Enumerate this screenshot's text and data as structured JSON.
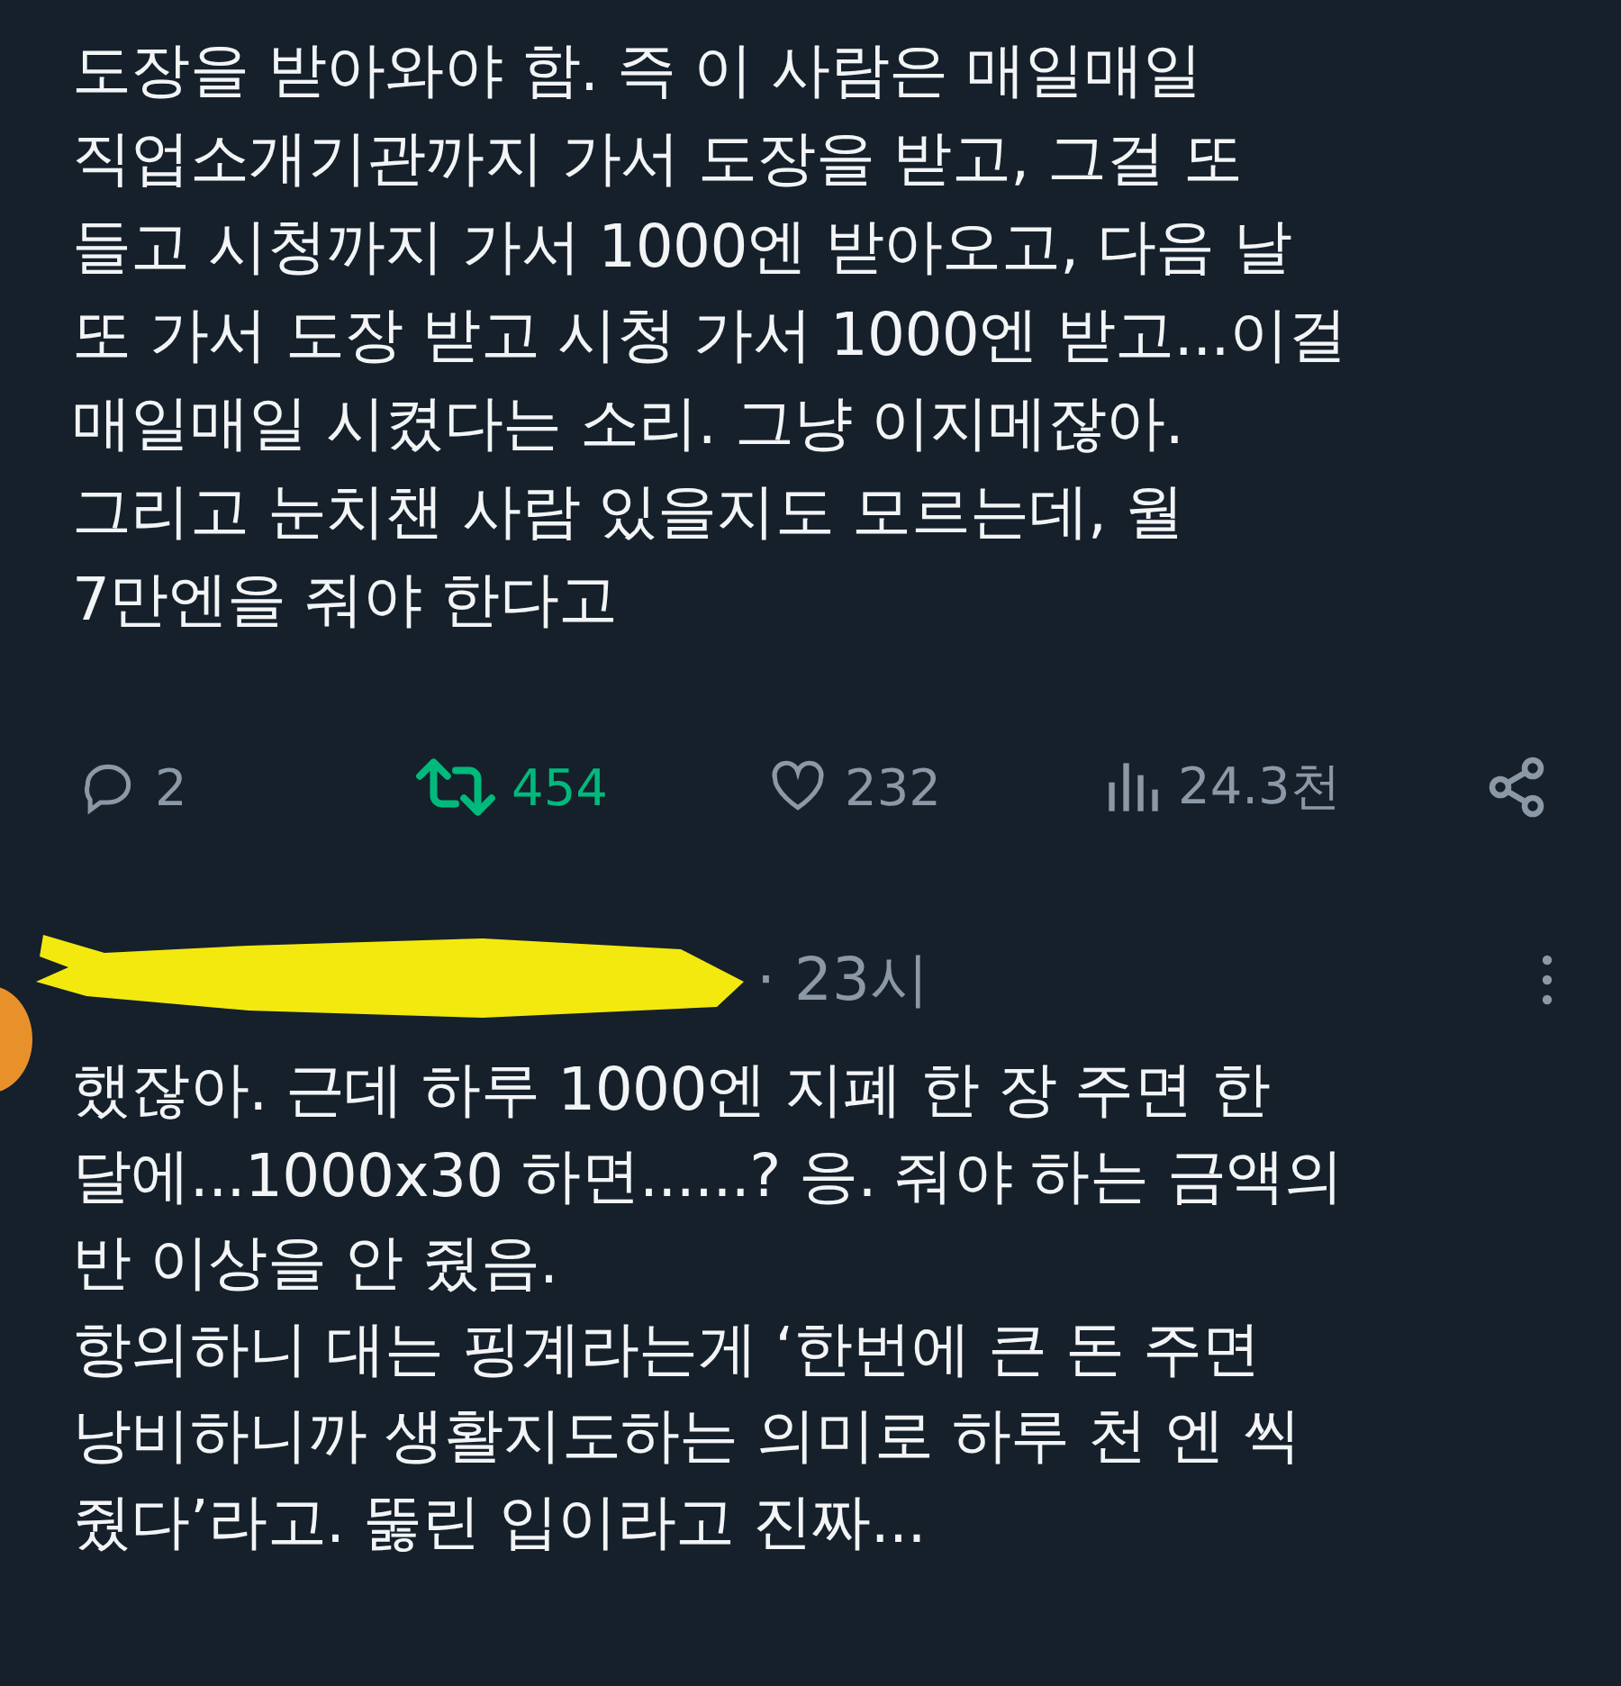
{
  "first_post": {
    "body": "도장을 받아와야 함. 즉 이 사람은 매일매일\n직업소개기관까지 가서 도장을 받고, 그걸 또\n들고 시청까지 가서 1000엔 받아오고, 다음 날\n또 가서 도장 받고 시청 가서 1000엔 받고...이걸\n매일매일 시켰다는 소리. 그냥 이지메잖아.\n그리고 눈치챈 사람 있을지도 모르는데, 월\n7만엔을 줘야 한다고",
    "actions": [
      {
        "kind": "reply",
        "count": "2",
        "selected": false
      },
      {
        "kind": "repost",
        "count": "454",
        "selected": true
      },
      {
        "kind": "like",
        "count": "232",
        "selected": false
      },
      {
        "kind": "views",
        "count": "24.3천"
      },
      {
        "kind": "share"
      }
    ]
  },
  "second_post": {
    "time": "· 23시",
    "body": "했잖아. 근데 하루 1000엔 지폐 한 장 주면 한\n달에...1000x30 하면......? 응. 줘야 하는 금액의\n반 이상을 안 줬음.\n항의하니 대는 핑계라는게 ‘한번에 큰 돈 주면\n낭비하니까 생활지도하는 의미로 하루 천 엔 씩\n줬다’라고. 뚫린 입이라고 진짜..."
  }
}
